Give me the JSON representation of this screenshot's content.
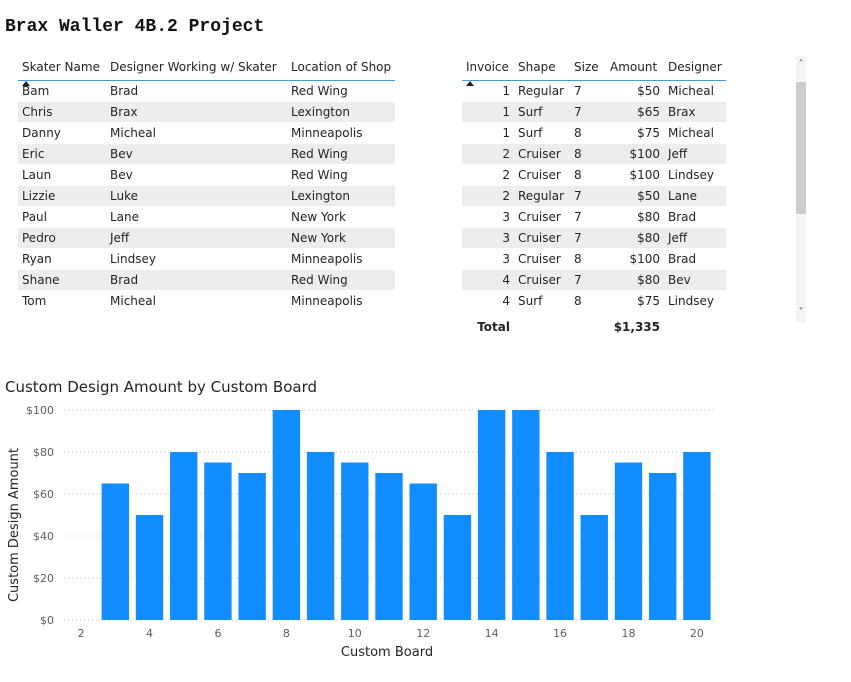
{
  "page": {
    "title": "Brax Waller 4B.2 Project"
  },
  "skater_table": {
    "headers": [
      "Skater Name",
      "Designer Working w/ Skater",
      "Location of Shop"
    ],
    "rows": [
      [
        "Bam",
        "Brad",
        "Red Wing"
      ],
      [
        "Chris",
        "Brax",
        "Lexington"
      ],
      [
        "Danny",
        "Micheal",
        "Minneapolis"
      ],
      [
        "Eric",
        "Bev",
        "Red Wing"
      ],
      [
        "Laun",
        "Bev",
        "Red Wing"
      ],
      [
        "Lizzie",
        "Luke",
        "Lexington"
      ],
      [
        "Paul",
        "Lane",
        "New York"
      ],
      [
        "Pedro",
        "Jeff",
        "New York"
      ],
      [
        "Ryan",
        "Lindsey",
        "Minneapolis"
      ],
      [
        "Shane",
        "Brad",
        "Red Wing"
      ],
      [
        "Tom",
        "Micheal",
        "Minneapolis"
      ]
    ]
  },
  "invoice_table": {
    "headers": [
      "Invoice",
      "Shape",
      "Size",
      "Amount",
      "Designer"
    ],
    "rows": [
      [
        "1",
        "Regular",
        "7",
        "$50",
        "Micheal"
      ],
      [
        "1",
        "Surf",
        "7",
        "$65",
        "Brax"
      ],
      [
        "1",
        "Surf",
        "8",
        "$75",
        "Micheal"
      ],
      [
        "2",
        "Cruiser",
        "8",
        "$100",
        "Jeff"
      ],
      [
        "2",
        "Cruiser",
        "8",
        "$100",
        "Lindsey"
      ],
      [
        "2",
        "Regular",
        "7",
        "$50",
        "Lane"
      ],
      [
        "3",
        "Cruiser",
        "7",
        "$80",
        "Brad"
      ],
      [
        "3",
        "Cruiser",
        "7",
        "$80",
        "Jeff"
      ],
      [
        "3",
        "Cruiser",
        "8",
        "$100",
        "Brad"
      ],
      [
        "4",
        "Cruiser",
        "7",
        "$80",
        "Bev"
      ],
      [
        "4",
        "Surf",
        "8",
        "$75",
        "Lindsey"
      ]
    ],
    "total_label": "Total",
    "total_amount": "$1,335"
  },
  "scrollbar": {
    "up_icon": "chevron-up-icon",
    "down_icon": "chevron-down-icon"
  },
  "chart_data": {
    "type": "bar",
    "title": "Custom Design Amount by Custom Board",
    "xlabel": "Custom Board",
    "ylabel": "Custom Design Amount",
    "x": [
      3,
      4,
      5,
      6,
      7,
      8,
      9,
      10,
      11,
      12,
      13,
      14,
      15,
      16,
      17,
      18,
      19,
      20
    ],
    "values": [
      65,
      50,
      80,
      75,
      70,
      100,
      80,
      75,
      70,
      65,
      50,
      100,
      100,
      80,
      50,
      75,
      70,
      80
    ],
    "xlim": [
      2,
      20
    ],
    "ylim": [
      0,
      100
    ],
    "x_ticks": [
      "2",
      "4",
      "6",
      "8",
      "10",
      "12",
      "14",
      "16",
      "18",
      "20"
    ],
    "y_ticks": [
      "$0",
      "$20",
      "$40",
      "$60",
      "$80",
      "$100"
    ],
    "grid": true,
    "bar_color": "#118dff"
  }
}
